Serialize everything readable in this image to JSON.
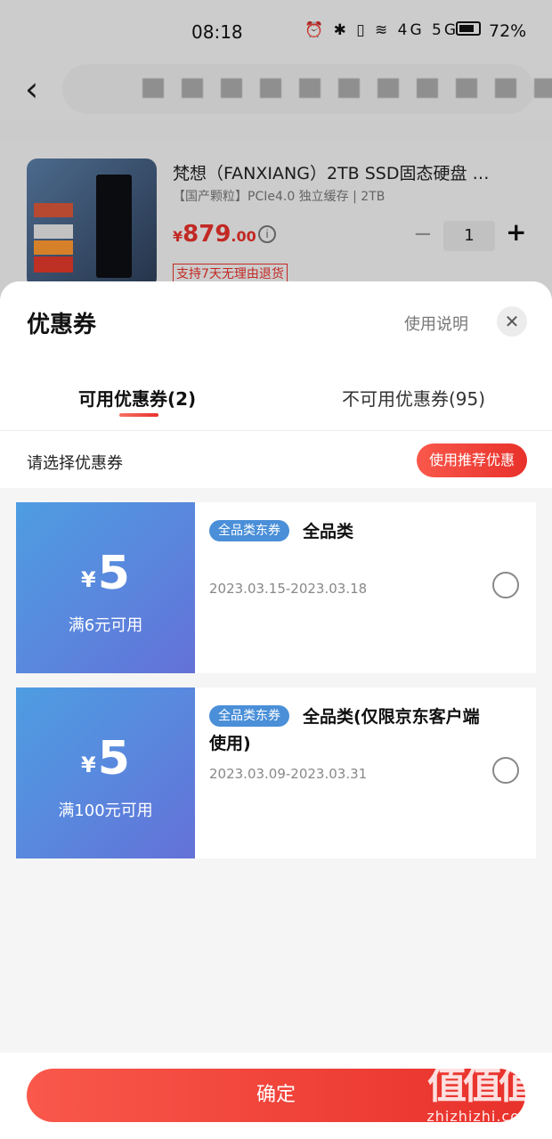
{
  "status_bar": {
    "time": "08:18",
    "icons": "⏰ ✱ ▯ ≋ 4G 5G",
    "battery": "72%"
  },
  "product": {
    "title": "梵想（FANXIANG）2TB SSD固态硬盘 …",
    "spec": "【国产颗粒】PCIe4.0 独立缓存 | 2TB",
    "price_symbol": "¥",
    "price_int": "879",
    "price_dec": ".00",
    "quantity": "1",
    "return_policy": "支持7天无理由退货"
  },
  "sheet": {
    "title": "优惠券",
    "help": "使用说明",
    "tabs": [
      {
        "label": "可用优惠券(2)"
      },
      {
        "label": "不可用优惠券(95)"
      }
    ],
    "select_hint": "请选择优惠券",
    "recommend_label": "使用推荐优惠",
    "confirm_label": "确定"
  },
  "coupons": [
    {
      "symbol": "¥",
      "amount": "5",
      "threshold": "满6元可用",
      "badge": "全品类东券",
      "name": "全品类",
      "name_cont": "",
      "validity": "2023.03.15-2023.03.18"
    },
    {
      "symbol": "¥",
      "amount": "5",
      "threshold": "满100元可用",
      "badge": "全品类东券",
      "name": "全品类(仅限京东客户端",
      "name_cont": "使用)",
      "validity": "2023.03.09-2023.03.31"
    }
  ],
  "watermark": {
    "logo": "值值值",
    "url": "zhizhizhi.com"
  },
  "colors": {
    "accent_red": "#e8312b",
    "coupon_blue": "#5a86dd"
  }
}
